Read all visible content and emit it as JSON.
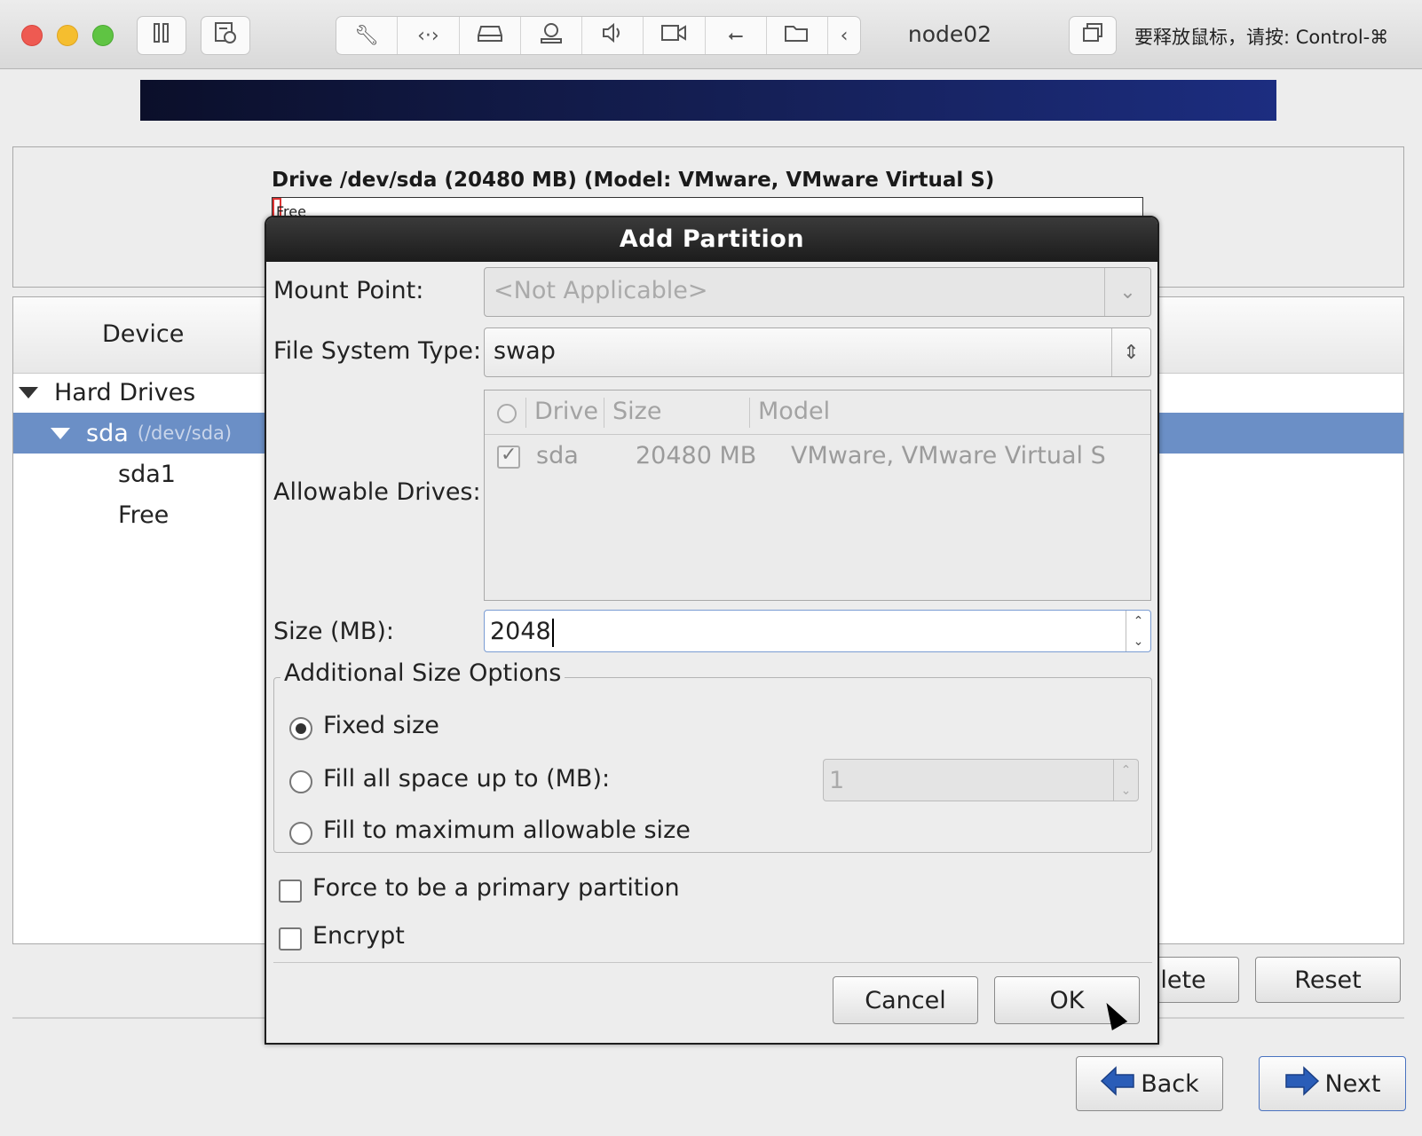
{
  "toolbar": {
    "vm_name": "node02",
    "release_hint": "要释放鼠标，请按: Control-⌘",
    "icons": [
      "pause-icon",
      "snapshot-icon",
      "settings-wrench-icon",
      "network-icon",
      "disk-icon",
      "camera-icon",
      "sound-icon",
      "video-icon",
      "usb-icon",
      "shared-folder-icon",
      "collapse-chevron-icon",
      "fullscreen-icon"
    ]
  },
  "installer": {
    "drive_title": "Drive /dev/sda (20480 MB) (Model: VMware, VMware Virtual S)",
    "drive_bar_label": "Free",
    "tree": {
      "column_device": "Device",
      "items": [
        {
          "label": "Hard Drives"
        },
        {
          "label": "sda",
          "sub": "(/dev/sda)"
        },
        {
          "label": "sda1"
        },
        {
          "label": "Free"
        }
      ]
    },
    "buttons": {
      "delete": "lete",
      "reset": "Reset",
      "back": "Back",
      "next": "Next"
    }
  },
  "dialog": {
    "title": "Add Partition",
    "mount_point": {
      "label": "Mount Point:",
      "value": "<Not Applicable>"
    },
    "fs_type": {
      "label": "File System Type:",
      "value": "swap"
    },
    "allowable_drives": {
      "label": "Allowable Drives:",
      "columns": [
        "Drive",
        "Size",
        "Model"
      ],
      "rows": [
        {
          "drive": "sda",
          "size": "20480 MB",
          "model": "VMware, VMware Virtual S",
          "checked": true
        }
      ]
    },
    "size": {
      "label": "Size (MB):",
      "value": "2048"
    },
    "size_options": {
      "legend": "Additional Size Options",
      "fixed": "Fixed size",
      "fill_upto": "Fill all space up to (MB):",
      "fill_upto_value": "1",
      "fill_max": "Fill to maximum allowable size",
      "selected": "fixed"
    },
    "force_primary": "Force to be a primary partition",
    "encrypt": "Encrypt",
    "cancel": "Cancel",
    "ok": "OK"
  }
}
